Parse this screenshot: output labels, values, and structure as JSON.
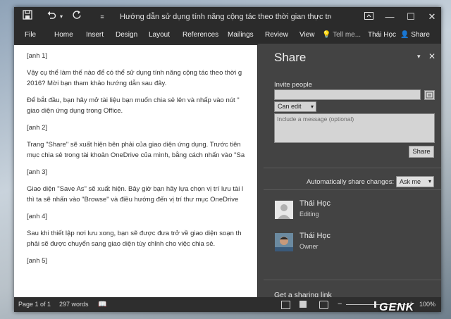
{
  "titlebar": {
    "title": "Hướng dẫn sử dụng tính năng cộng tác theo thời gian thực trong Office...",
    "save_icon": "save-icon",
    "undo_icon": "undo-icon",
    "redo_icon": "redo-icon"
  },
  "ribbon": {
    "tabs": [
      "File",
      "Home",
      "Insert",
      "Design",
      "Layout",
      "References",
      "Mailings",
      "Review",
      "View"
    ],
    "tell_me": "Tell me...",
    "user": "Thái Học",
    "share_label": "Share"
  },
  "document": {
    "lines": [
      "[anh 1]",
      "Vậy cụ thể làm thế nào để có thể sử dụng tính năng cộng tác theo thời g",
      "2016? Mời bạn tham khảo hướng dẫn sau đây.",
      "Để bắt đầu, bạn hãy mở tài liệu bạn muốn chia sẻ lên và nhấp vào nút \"",
      "giao diện ứng dụng trong Office.",
      "[anh 2]",
      "Trang \"Share\" sẽ xuất hiện bên phải của giao diện ứng dụng. Trước tiên",
      "mục chia sẻ trong tài khoản OneDrive của mình, bằng cách nhấn vào \"Sa",
      "[anh 3]",
      "Giao diện \"Save As\" sẽ xuất hiện. Bây giờ bạn hãy lựa chọn vị trí lưu tài l",
      "thì ta sẽ nhấn vào \"Browse\" và điều hướng đến vị trí thư mục OneDrive",
      "[anh 4]",
      "Sau khi thiết lập nơi lưu xong, bạn sẽ được đưa trở về giao diện soạn th",
      "phải sẽ được chuyển sang giao diện tùy chỉnh cho việc chia sẻ.",
      "[anh 5]"
    ]
  },
  "share_pane": {
    "title": "Share",
    "invite_label": "Invite people",
    "invite_value": "",
    "permission": "Can edit",
    "message_placeholder": "Include a message (optional)",
    "share_button": "Share",
    "auto_share_label": "Automatically share changes:",
    "auto_share_value": "Ask me",
    "people": [
      {
        "name": "Thái Học",
        "role": "Editing"
      },
      {
        "name": "Thái Học",
        "role": "Owner"
      }
    ],
    "sharing_link": "Get a sharing link"
  },
  "status": {
    "page": "Page 1 of 1",
    "words": "297 words",
    "zoom": "100%"
  },
  "watermark": "GENK"
}
